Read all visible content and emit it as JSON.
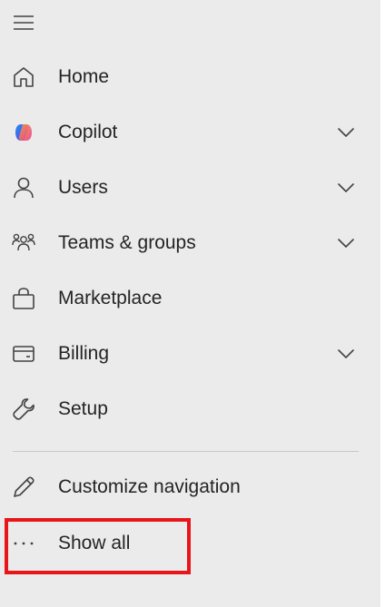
{
  "nav": {
    "items": [
      {
        "label": "Home",
        "icon": "home-icon",
        "has_chevron": false
      },
      {
        "label": "Copilot",
        "icon": "copilot-icon",
        "has_chevron": true
      },
      {
        "label": "Users",
        "icon": "person-icon",
        "has_chevron": true
      },
      {
        "label": "Teams & groups",
        "icon": "people-team-icon",
        "has_chevron": true
      },
      {
        "label": "Marketplace",
        "icon": "shopping-bag-icon",
        "has_chevron": false
      },
      {
        "label": "Billing",
        "icon": "credit-card-icon",
        "has_chevron": true
      },
      {
        "label": "Setup",
        "icon": "wrench-icon",
        "has_chevron": false
      }
    ],
    "customize_label": "Customize navigation",
    "show_all_label": "Show all"
  },
  "colors": {
    "panel_background": "#ebebeb",
    "text": "#242424",
    "icon": "#424242",
    "highlight_border": "#e8151b"
  }
}
